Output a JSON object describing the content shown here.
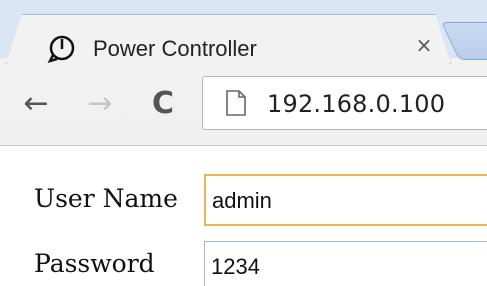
{
  "browser": {
    "tab": {
      "title": "Power Controller",
      "close_glyph": "×",
      "favicon": "power-icon"
    },
    "toolbar": {
      "back_glyph": "←",
      "forward_glyph": "→",
      "reload_glyph": "C",
      "url": "192.168.0.100"
    }
  },
  "login_form": {
    "username": {
      "label": "User Name",
      "value": "admin"
    },
    "password": {
      "label": "Password",
      "value": "1234"
    }
  },
  "colors": {
    "focus_border": "#e8b657",
    "tab_strip": "#dbe6f5"
  }
}
